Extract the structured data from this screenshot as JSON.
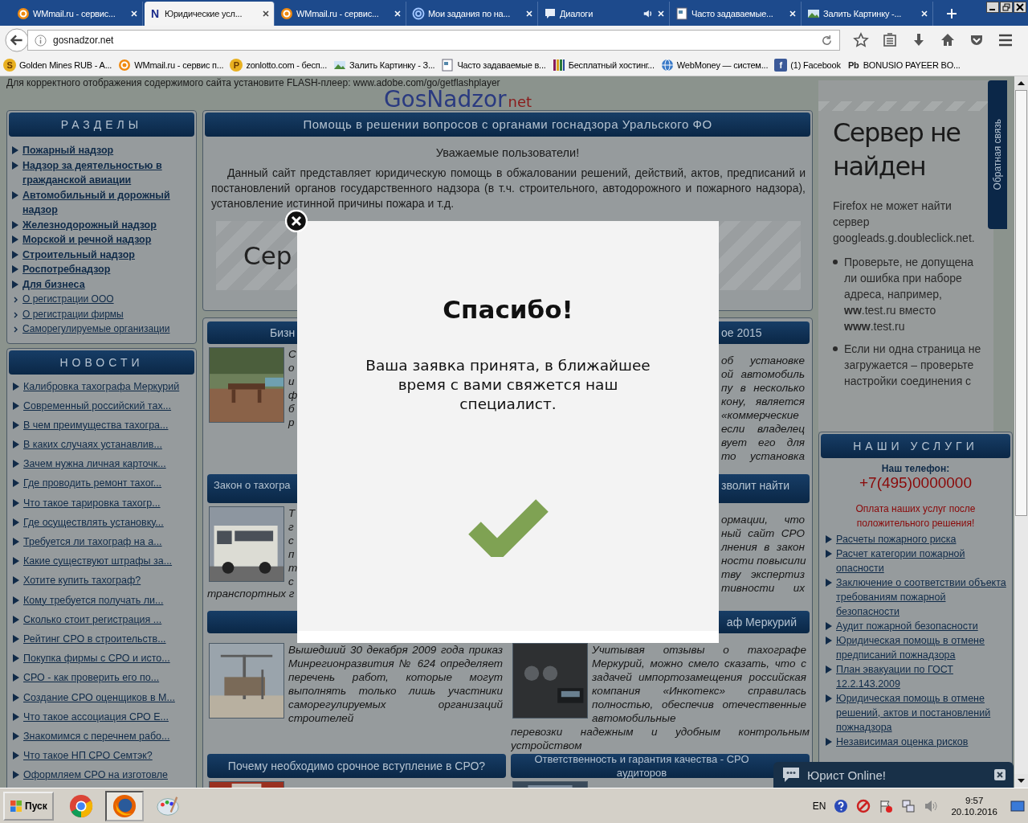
{
  "browser": {
    "tabs": [
      {
        "title": "WMmail.ru - сервис...",
        "selected": false
      },
      {
        "favicon_text": "N",
        "title": "Юридические усл...",
        "selected": true
      },
      {
        "title": "WMmail.ru - сервис...",
        "selected": false
      },
      {
        "title": "Мои задания по на...",
        "selected": false
      },
      {
        "title": "Диалоги",
        "selected": false,
        "audio": true
      },
      {
        "title": "Часто задаваемые...",
        "selected": false
      },
      {
        "title": "Залить Картинку -...",
        "selected": false
      }
    ],
    "address": "gosnadzor.net",
    "bookmarks": [
      {
        "favicon_text": "S",
        "title": "Golden Mines RUB - A..."
      },
      {
        "title": "WMmail.ru - сервис п..."
      },
      {
        "favicon_text": "P",
        "title": "zonlotto.com - бесп..."
      },
      {
        "title": "Залить Картинку - З..."
      },
      {
        "title": "Часто задаваемые в..."
      },
      {
        "title": "Бесплатный хостинг..."
      },
      {
        "title": "WebMoney — систем..."
      },
      {
        "favicon_text": "f",
        "title": "(1) Facebook"
      },
      {
        "favicon_text": "Pb",
        "title": "BONUSIO PAYEER BO..."
      }
    ]
  },
  "page": {
    "flash_notice": "Для корректного отображения содержимого сайта установите FLASH-плеер: www.adobe.com/go/getflashplayer",
    "logo": {
      "name": "GosNadzor",
      "suffix": "net"
    },
    "feedback_tab": "Обратная связь",
    "sections": {
      "title": "РАЗДЕЛЫ",
      "items": [
        {
          "kind": "main",
          "label": "Пожарный надзор"
        },
        {
          "kind": "main",
          "label": "Надзор за деятельностью в гражданской авиации"
        },
        {
          "kind": "main",
          "label": "Автомобильный и дорожный надзор"
        },
        {
          "kind": "main",
          "label": "Железнодорожный надзор"
        },
        {
          "kind": "main",
          "label": "Морской и речной надзор"
        },
        {
          "kind": "main",
          "label": "Строительный надзор"
        },
        {
          "kind": "main",
          "label": "Роспотребнадзор"
        },
        {
          "kind": "main",
          "label": "Для бизнеса"
        },
        {
          "kind": "sub",
          "label": "О регистрации ООО"
        },
        {
          "kind": "sub",
          "label": "О регистрации фирмы"
        },
        {
          "kind": "sub",
          "label": "Саморегулируемые организации"
        }
      ]
    },
    "news": {
      "title": "НОВОСТИ",
      "items": [
        "Калибровка тахографа Меркурий",
        "Современный российский тах...",
        "В чем преимущества тахогра...",
        "В каких случаях устанавлив...",
        "Зачем нужна личная карточк...",
        "Где проводить ремонт тахог...",
        "Что такое тарировка тахогр...",
        "Где осуществлять установку...",
        "Требуется ли тахограф на а...",
        "Какие существуют штрафы за...",
        "Хотите купить тахограф?",
        "Кому требуется получать ли...",
        "Сколько стоит регистрация ...",
        "Рейтинг СРО в строительств...",
        "Покупка фирмы с СРО и исто...",
        "СРО - как проверить его по...",
        "Создание СРО оценщиков в М...",
        "Что такое ассоциация СРО Е...",
        "Знакомимся с перечнем рабо...",
        "Что такое НП СРО Семтэк?",
        "Оформляем СРО на изготовле"
      ]
    },
    "intro": {
      "title": "Помощь в решении вопросов с органами госнадзора Уральского ФО",
      "greeting": "Уважаемые пользователи!",
      "text": "Данный сайт представляет юридическую помощь в обжаловании решений, действий, актов, предписаний и постановлений органов государственного надзора (в т.ч. строительного, автодорожного и пожарного надзора), установление истинной причины пожара и т.д.",
      "embed_fragment": "Сер"
    },
    "articles": [
      {
        "kind": "cut_left",
        "title": "Бизн",
        "letters": [
          "С",
          "о",
          "и",
          "ф",
          "б",
          "р"
        ]
      },
      {
        "kind": "cut_right",
        "title": "ое 2015",
        "lines": [
          "об установке",
          "ой автомобиль",
          "пу в несколько",
          "кону, является",
          "«коммерческие",
          "если владелец",
          "вует его для",
          "то установка"
        ]
      },
      {
        "kind": "cut_left",
        "title": "Закон о тахогра",
        "letters": [
          "Т",
          "г",
          "с",
          "п",
          "т",
          "с"
        ],
        "tail": "транспортных г"
      },
      {
        "kind": "cut_right",
        "title": "зволит найти",
        "lines": [
          "ормации, что",
          "ный сайт СРО",
          "лнения в закон",
          "ности повысили",
          "тву экспертиз",
          "тивности их"
        ]
      },
      {
        "kind": "full",
        "text": "Вышедший 30 декабря 2009 года приказ Минрегионразвития № 624 определяет перечень работ, которые могут выполнять только лишь участники саморегулируемых организаций строителей"
      },
      {
        "kind": "full",
        "title": "аф Меркурий",
        "text": "Учитывая отзывы о тахографе Меркурий, можно смело сказать, что с задачей импортозамещения российская компания «Инкотекс» справилась полностью, обеспечив отечественные автомобильные",
        "tail": "перевозки надежным и удобным контрольным устройством"
      },
      {
        "kind": "stub",
        "title": "Почему необходимо срочное вступление в СРО?"
      },
      {
        "kind": "stub",
        "title": "Ответственность и гарантия качества - СРО аудиторов"
      }
    ],
    "error_page": {
      "title": "Сервер не найден",
      "text": "Firefox не может найти сервер googleads.g.doubleclick.net.",
      "bullets": [
        "Проверьте, не допущена ли ошибка при наборе адреса, например, **ww**.test.ru вместо **www**.test.ru",
        "Если ни одна страница не загружается – проверьте настройки соединения с"
      ]
    },
    "services": {
      "title": "НАШИ УСЛУГИ",
      "phone_label": "Наш телефон:",
      "phone": "+7(495)0000000",
      "note": "Оплата наших услуг после положительного решения!",
      "items": [
        "Расчеты пожарного риска",
        "Расчет категории пожарной опасности",
        "Заключение о соответствии объекта требованиям пожарной безопасности",
        "Аудит пожарной безопасности",
        "Юридическая помощь в отмене предписаний пожнадзора",
        "План эвакуации по ГОСТ 12.2.143.2009",
        "Юридическая помощь в отмене решений, актов и постановлений пожнадзора",
        "Независимая оценка рисков"
      ]
    },
    "chat": {
      "title": "Юрист Online!"
    }
  },
  "modal": {
    "title": "Спасибо!",
    "message": "Ваша заявка принята, в ближайшее время с вами свяжется наш специалист."
  },
  "taskbar": {
    "start": "Пуск",
    "apps": [
      {
        "selected": false
      },
      {
        "selected": true
      },
      {
        "selected": false
      }
    ],
    "language": "EN",
    "time": "9:57",
    "date": "20.10.2016"
  }
}
